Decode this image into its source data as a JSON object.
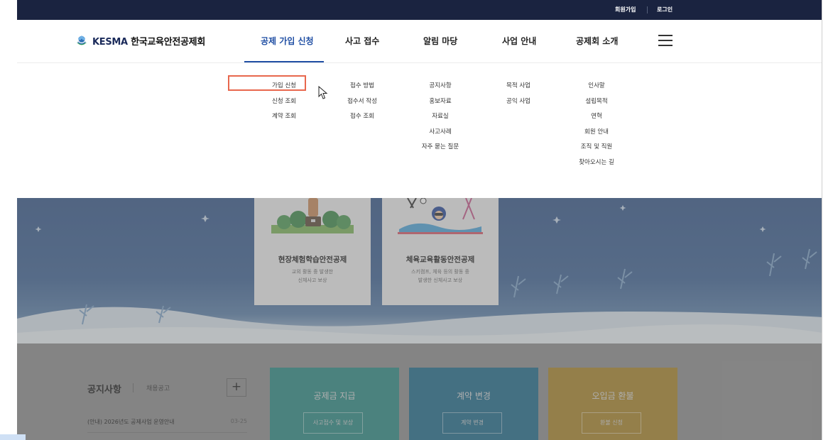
{
  "top_bar": {
    "signup": "회원가입",
    "login": "로그인"
  },
  "header": {
    "logo_en": "KESMA",
    "logo_ko": "한국교육안전공제회",
    "nav": [
      "공제 가입 신청",
      "사고 접수",
      "알림 마당",
      "사업 안내",
      "공제회 소개"
    ],
    "active_nav": "공제 가입 신청"
  },
  "mega_menu": {
    "columns": [
      [
        "가입 신청",
        "신청 조회",
        "계약 조회"
      ],
      [
        "접수 방법",
        "접수서 작성",
        "접수 조회"
      ],
      [
        "공지사항",
        "홍보자료",
        "자료실",
        "사고사례",
        "자주 묻는 질문"
      ],
      [
        "목적 사업",
        "공익 사업"
      ],
      [
        "인사말",
        "설립목적",
        "연혁",
        "회원 안내",
        "조직 및 직원",
        "찾아오시는 길"
      ]
    ],
    "highlighted_item": "가입 신청"
  },
  "hero": {
    "cards": [
      {
        "title": "현장체험학습안전공제",
        "desc1": "교외 활동 중 발생한",
        "desc2": "신체사고 보상"
      },
      {
        "title": "체육교육활동안전공제",
        "desc1": "스키캠프, 체육 등의 활동 중",
        "desc2": "발생한 신체사고 보상"
      }
    ]
  },
  "notice": {
    "title": "공지사항",
    "tab": "채용공고",
    "plus": "+",
    "items": [
      {
        "title": "(안내) 2026년도 공제사업 운영안내",
        "date": "03-25"
      }
    ]
  },
  "tiles": [
    {
      "title": "공제금 지급",
      "button": "사고접수 및 보상",
      "color": "#2c8a84"
    },
    {
      "title": "계약 변경",
      "button": "계약 변경",
      "color": "#1f6b8a"
    },
    {
      "title": "오입금 환불",
      "button": "환불 신청",
      "color": "#a9862a"
    }
  ],
  "colors": {
    "accent": "#1f4ea3",
    "topbar": "#1a2340",
    "highlight": "#e8674d"
  }
}
